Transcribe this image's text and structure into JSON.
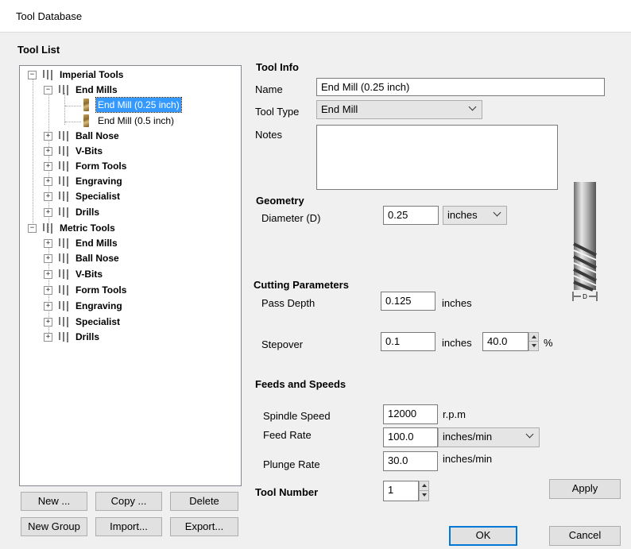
{
  "window": {
    "title": "Tool Database"
  },
  "tool_list": {
    "heading": "Tool List",
    "tree": [
      {
        "label": "Imperial Tools",
        "expanded": true
      },
      {
        "label": "End Mills",
        "expanded": true
      },
      {
        "label": "End Mill (0.25 inch)",
        "selected": true
      },
      {
        "label": "End Mill (0.5 inch)"
      },
      {
        "label": "Ball Nose"
      },
      {
        "label": "V-Bits"
      },
      {
        "label": "Form Tools"
      },
      {
        "label": "Engraving"
      },
      {
        "label": "Specialist"
      },
      {
        "label": "Drills"
      },
      {
        "label": "Metric Tools",
        "expanded": true
      },
      {
        "label": "End Mills"
      },
      {
        "label": "Ball Nose"
      },
      {
        "label": "V-Bits"
      },
      {
        "label": "Form Tools"
      },
      {
        "label": "Engraving"
      },
      {
        "label": "Specialist"
      },
      {
        "label": "Drills"
      }
    ],
    "buttons": {
      "new": "New ...",
      "copy": "Copy ...",
      "delete": "Delete",
      "new_group": "New Group",
      "import": "Import...",
      "export": "Export..."
    }
  },
  "tool_info": {
    "heading": "Tool Info",
    "name_label": "Name",
    "name_value": "End Mill (0.25 inch)",
    "type_label": "Tool Type",
    "type_value": "End Mill",
    "notes_label": "Notes",
    "notes_value": ""
  },
  "geometry": {
    "heading": "Geometry",
    "diameter_label": "Diameter (D)",
    "diameter_value": "0.25",
    "units_value": "inches",
    "diagram_label": "D"
  },
  "cutting": {
    "heading": "Cutting Parameters",
    "pass_depth_label": "Pass Depth",
    "pass_depth_value": "0.125",
    "pass_depth_unit": "inches",
    "stepover_label": "Stepover",
    "stepover_value": "0.1",
    "stepover_unit": "inches",
    "stepover_percent": "40.0",
    "percent_sign": "%"
  },
  "feeds": {
    "heading": "Feeds and Speeds",
    "spindle_label": "Spindle Speed",
    "spindle_value": "12000",
    "spindle_unit": "r.p.m",
    "feed_label": "Feed Rate",
    "feed_value": "100.0",
    "feed_unit": "inches/min",
    "plunge_label": "Plunge Rate",
    "plunge_value": "30.0",
    "plunge_unit": "inches/min"
  },
  "tool_number": {
    "label": "Tool Number",
    "value": "1"
  },
  "actions": {
    "apply": "Apply",
    "ok": "OK",
    "cancel": "Cancel"
  }
}
